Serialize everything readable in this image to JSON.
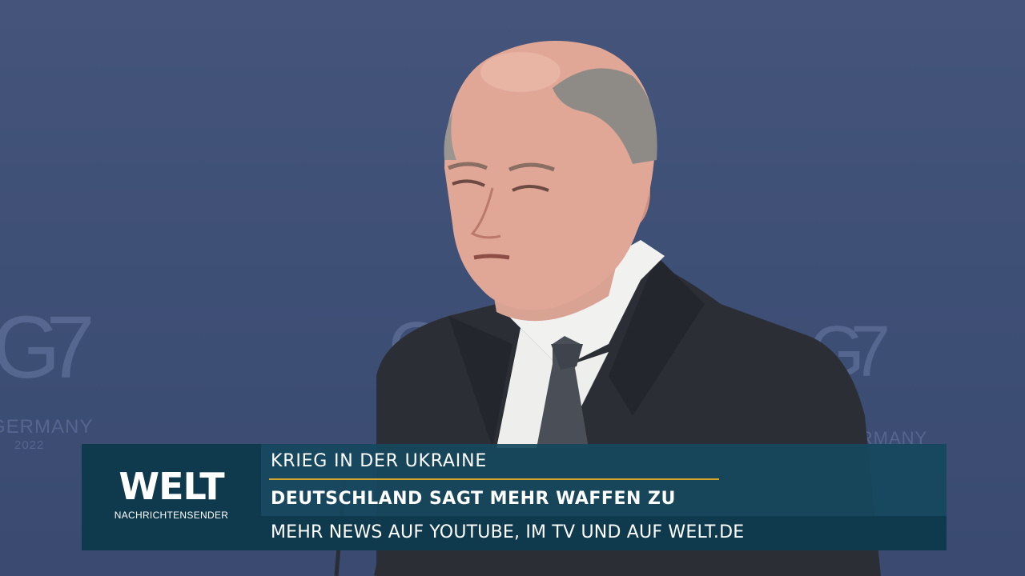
{
  "backdrop": {
    "g7_mark": "G7",
    "country": "GERMANY",
    "year": "2022"
  },
  "lower_third": {
    "brand": {
      "logo_text": "WELT",
      "subtitle": "NACHRICHTENSENDER"
    },
    "topic": "KRIEG IN DER UKRAINE",
    "headline": "DEUTSCHLAND SAGT MEHR WAFFEN ZU",
    "ticker": "MEHR NEWS AUF YOUTUBE, IM TV UND AUF WELT.DE"
  },
  "colors": {
    "backdrop": "#3e4f76",
    "brand_panel": "#0f3a4e",
    "headline_panel": "#16485e",
    "accent": "#d6a52d"
  }
}
